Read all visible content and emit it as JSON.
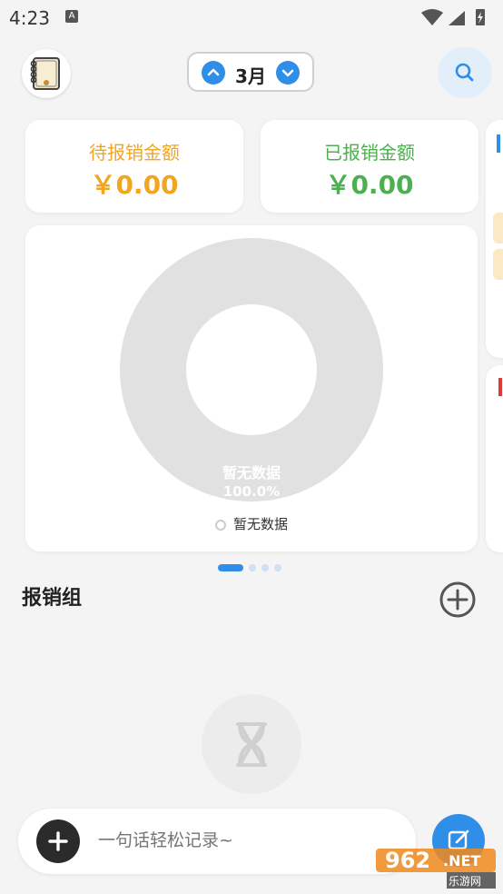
{
  "status_bar": {
    "time": "4:23",
    "notification_letter": "A"
  },
  "header": {
    "month_label": "3月"
  },
  "stats": {
    "pending": {
      "title": "待报销金额",
      "value": "￥0.00",
      "color": "#f2a51e"
    },
    "reimbursed": {
      "title": "已报销金额",
      "value": "￥0.00",
      "color": "#4caf50"
    }
  },
  "chart": {
    "center_label": "暂无数据",
    "center_percent": "100.0%",
    "legend_label": "暂无数据"
  },
  "chart_data": {
    "type": "pie",
    "categories": [
      "暂无数据"
    ],
    "values": [
      100.0
    ]
  },
  "pagination": {
    "pages": 4,
    "active": 0
  },
  "section": {
    "title": "报销组"
  },
  "input": {
    "placeholder": "一句话轻松记录~"
  },
  "watermark": {
    "number": "962",
    "net": ".NET",
    "sub": "乐游网"
  },
  "colors": {
    "accent": "#2f8fe8",
    "background": "#f4f4f4"
  }
}
